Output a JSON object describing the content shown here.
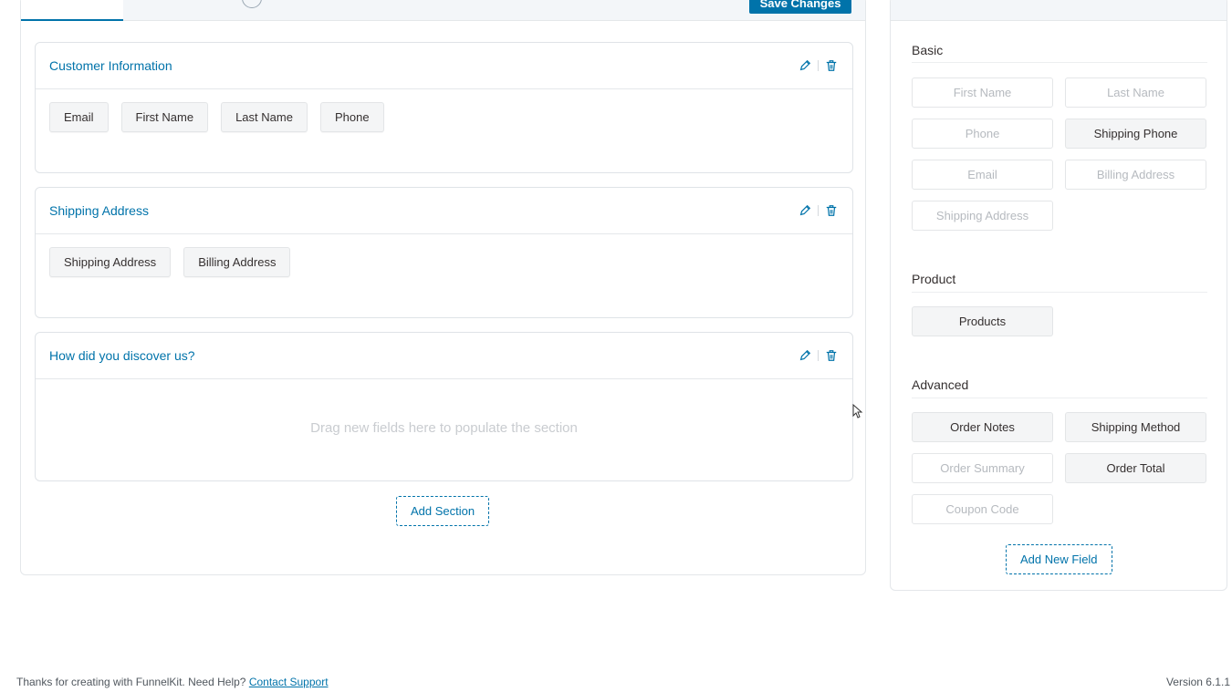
{
  "toolbar": {
    "save_label": "Save Changes"
  },
  "sections": [
    {
      "title": "Customer Information",
      "fields": [
        "Email",
        "First Name",
        "Last Name",
        "Phone"
      ]
    },
    {
      "title": "Shipping Address",
      "fields": [
        "Shipping Address",
        "Billing Address"
      ]
    },
    {
      "title": "How did you discover us?",
      "fields": [],
      "empty_hint": "Drag new fields here to populate the section"
    }
  ],
  "add_section_label": "Add Section",
  "fields_panel": {
    "groups": [
      {
        "title": "Basic",
        "fields": [
          {
            "label": "First Name",
            "used": false
          },
          {
            "label": "Last Name",
            "used": false
          },
          {
            "label": "Phone",
            "used": false
          },
          {
            "label": "Shipping Phone",
            "used": true
          },
          {
            "label": "Email",
            "used": false
          },
          {
            "label": "Billing Address",
            "used": false
          },
          {
            "label": "Shipping Address",
            "used": false
          }
        ]
      },
      {
        "title": "Product",
        "fields": [
          {
            "label": "Products",
            "used": true
          }
        ]
      },
      {
        "title": "Advanced",
        "fields": [
          {
            "label": "Order Notes",
            "used": true
          },
          {
            "label": "Shipping Method",
            "used": true
          },
          {
            "label": "Order Summary",
            "used": false
          },
          {
            "label": "Order Total",
            "used": true
          },
          {
            "label": "Coupon Code",
            "used": false
          }
        ]
      }
    ],
    "add_field_label": "Add New Field"
  },
  "footer": {
    "text": "Thanks for creating with FunnelKit. Need Help?",
    "link": "Contact Support",
    "version": "Version 6.1.1"
  },
  "colors": {
    "accent": "#0073aa",
    "chip_bg": "#f4f5f6",
    "muted_text": "#b6babf"
  }
}
